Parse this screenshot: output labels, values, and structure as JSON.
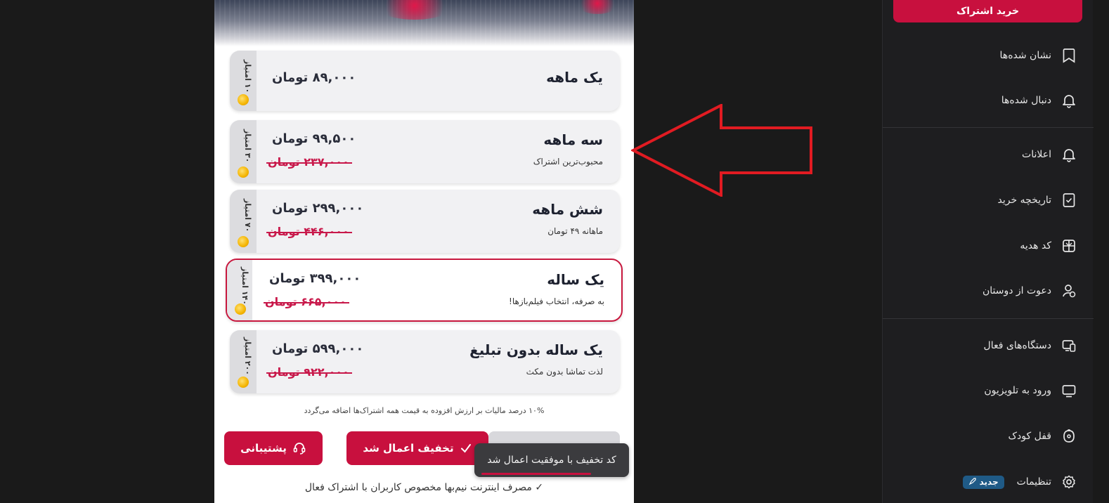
{
  "plans": [
    {
      "name": "یک ماهه",
      "subtitle": "",
      "price": "۸۹,۰۰۰ تومان",
      "old_price": "",
      "points": "۱۰ امتیاز"
    },
    {
      "name": "سه ماهه",
      "subtitle": "محبوب‌ترین اشتراک",
      "price": "۹۹,۵۰۰ تومان",
      "old_price": "۲۳۷,۰۰۰ تومان",
      "points": "۳۰ امتیاز"
    },
    {
      "name": "شش ماهه",
      "subtitle": "ماهانه ۴۹ تومان",
      "price": "۲۹۹,۰۰۰ تومان",
      "old_price": "۴۴۶,۰۰۰ تومان",
      "points": "۷۰ امتیاز"
    },
    {
      "name": "یک ساله",
      "subtitle": "به صرفه، انتخاب فیلم‌بازها!",
      "price": "۳۹۹,۰۰۰ تومان",
      "old_price": "۶۶۵,۰۰۰ تومان",
      "points": "۱۴۰ امتیاز"
    },
    {
      "name": "یک ساله بدون تبلیغ",
      "subtitle": "لذت تماشا بدون مکث",
      "price": "۵۹۹,۰۰۰ تومان",
      "old_price": "۹۲۲,۰۰۰ تومان",
      "points": "۲۰۰ امتیاز"
    }
  ],
  "tax_note": "۱۰% درصد مالیات بر ارزش افزوده به قیمت همه اشتراک‌ها اضافه می‌گردد",
  "buttons": {
    "support": "پشتیبانی",
    "discount_applied": "تخفیف اعمال شد"
  },
  "toast": "کد تخفیف با موفقیت اعمال شد",
  "bottom_note": "✓ مصرف اینترنت نیم‌بها مخصوص کاربران با اشتراک فعال",
  "sidebar": {
    "buy_button": "خرید اشتراک",
    "items": [
      {
        "label": "نشان شده‌ها",
        "icon": "bookmark-icon"
      },
      {
        "label": "دنبال شده‌ها",
        "icon": "bell-icon"
      },
      {
        "label": "اعلانات",
        "icon": "bell-icon"
      },
      {
        "label": "تاریخچه خرید",
        "icon": "receipt-icon"
      },
      {
        "label": "کد هدیه",
        "icon": "gift-icon"
      },
      {
        "label": "دعوت از دوستان",
        "icon": "invite-user-icon"
      },
      {
        "label": "دستگاه‌های فعال",
        "icon": "devices-icon"
      },
      {
        "label": "ورود به تلویزیون",
        "icon": "tv-icon"
      },
      {
        "label": "قفل کودک",
        "icon": "child-lock-icon"
      },
      {
        "label": "تنظیمات",
        "icon": "gear-icon"
      }
    ],
    "new_badge": "جدید"
  },
  "colors": {
    "brand": "#c8103e",
    "old_price": "#c8184a",
    "badge": "#1f5a86",
    "sidebar_bg": "#1e1e20"
  }
}
